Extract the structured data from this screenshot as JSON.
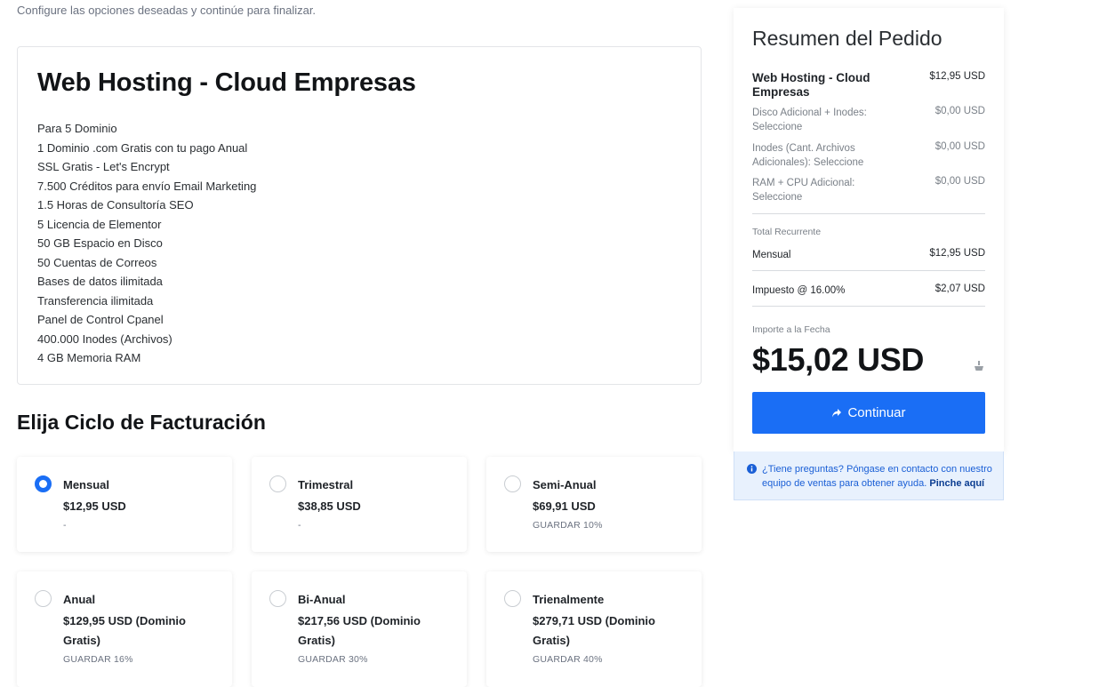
{
  "intro_text": "Configure las opciones deseadas y continúe para finalizar.",
  "product": {
    "title": "Web Hosting - Cloud Empresas",
    "features": [
      "Para 5 Dominio",
      "1 Dominio .com Gratis con tu pago Anual",
      "SSL Gratis - Let's Encrypt",
      "7.500 Créditos para envío Email Marketing",
      "1.5 Horas de Consultoría SEO",
      "5 Licencia de Elementor",
      "50 GB Espacio en Disco",
      "50 Cuentas de Correos",
      "Bases de datos ilimitada",
      "Transferencia ilimitada",
      "Panel de Control Cpanel",
      "400.000 Inodes (Archivos)",
      "4 GB Memoria RAM"
    ]
  },
  "billing": {
    "title": "Elija Ciclo de Facturación",
    "selected": "Mensual",
    "cycles": [
      {
        "name": "Mensual",
        "price": "$12,95 USD",
        "saving": "-"
      },
      {
        "name": "Trimestral",
        "price": "$38,85 USD",
        "saving": "-"
      },
      {
        "name": "Semi-Anual",
        "price": "$69,91 USD",
        "saving": "GUARDAR 10%"
      },
      {
        "name": "Anual",
        "price": "$129,95 USD (Dominio Gratis)",
        "saving": "GUARDAR 16%"
      },
      {
        "name": "Bi-Anual",
        "price": "$217,56 USD (Dominio Gratis)",
        "saving": "GUARDAR 30%"
      },
      {
        "name": "Trienalmente",
        "price": "$279,71 USD (Dominio Gratis)",
        "saving": "GUARDAR 40%"
      }
    ]
  },
  "summary": {
    "title": "Resumen del Pedido",
    "product_name": "Web Hosting - Cloud Empresas",
    "product_price": "$12,95 USD",
    "options": [
      {
        "label": "Disco Adicional + Inodes: Seleccione",
        "value": "$0,00 USD"
      },
      {
        "label": "Inodes (Cant. Archivos Adicionales): Seleccione",
        "value": "$0,00 USD"
      },
      {
        "label": "RAM + CPU Adicional: Seleccione",
        "value": "$0,00 USD"
      }
    ],
    "recurring_label": "Total Recurrente",
    "recurring": {
      "label": "Mensual",
      "value": "$12,95 USD"
    },
    "tax": {
      "label": "Impuesto @ 16.00%",
      "value": "$2,07 USD"
    },
    "due_label": "Importe a la Fecha",
    "due_total": "$15,02 USD",
    "continue_label": "Continuar"
  },
  "help": {
    "text": "¿Tiene preguntas? Póngase en contacto con nuestro equipo de ventas para obtener ayuda.",
    "link": "Pinche aquí"
  },
  "colors": {
    "accent": "#1a6ef5",
    "help_bg": "#e8f1fd"
  }
}
